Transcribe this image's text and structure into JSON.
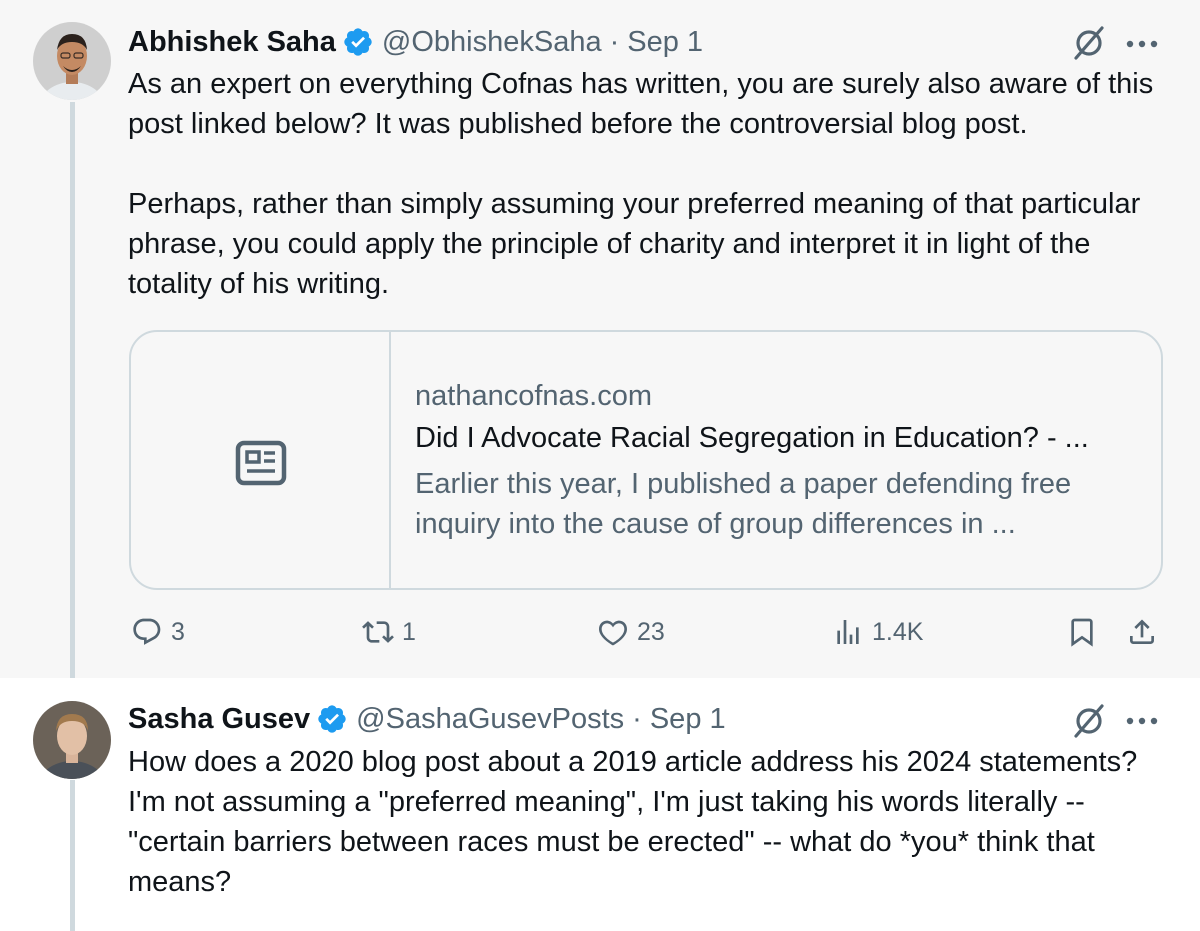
{
  "tweets": [
    {
      "author_name": "Abhishek Saha",
      "handle": "@ObhishekSaha",
      "separator": "·",
      "date": "Sep 1",
      "verified": true,
      "paragraphs": [
        "As an expert on everything Cofnas has written, you are surely also aware of this post linked below? It was published before the controversial blog post.",
        "Perhaps, rather than simply assuming your preferred meaning of that particular phrase, you could apply the principle of charity and interpret it in light of the totality of his writing."
      ],
      "card": {
        "domain": "nathancofnas.com",
        "title": "Did I Advocate Racial Segregation in Education? - ...",
        "description": "Earlier this year, I published a paper defending free inquiry into the cause of group differences in ...",
        "thumb_icon": "article-icon"
      },
      "actions": {
        "replies": "3",
        "reposts": "1",
        "likes": "23",
        "views": "1.4K"
      }
    },
    {
      "author_name": "Sasha Gusev",
      "handle": "@SashaGusevPosts",
      "separator": "·",
      "date": "Sep 1",
      "verified": true,
      "paragraphs": [
        "How does a 2020 blog post about a 2019 article address his 2024 statements? I'm not assuming a \"preferred meaning\", I'm just taking his words literally -- \"certain barriers between races must be erected\" -- what do *you* think that means?"
      ]
    }
  ],
  "colors": {
    "verified_blue": "#1d9bf0",
    "muted_text": "#536471",
    "primary_text": "#0f1419",
    "border": "#cfd9de",
    "highlight_bg": "#f7f7f7"
  },
  "icons": [
    "verified-badge-icon",
    "grok-icon",
    "more-icon",
    "reply-icon",
    "repost-icon",
    "like-icon",
    "views-icon",
    "bookmark-icon",
    "share-icon",
    "article-icon"
  ]
}
